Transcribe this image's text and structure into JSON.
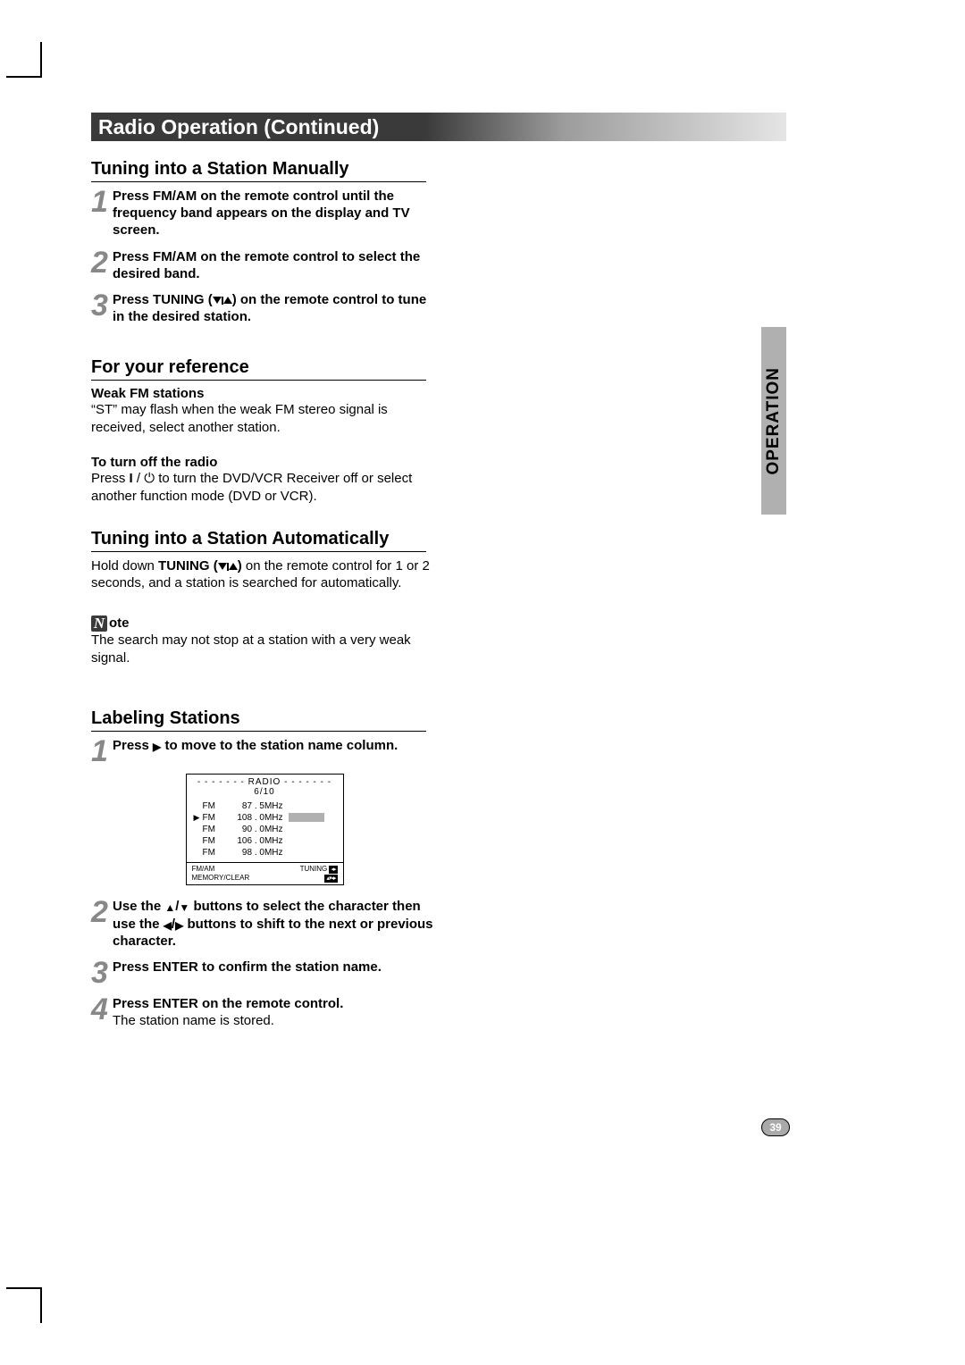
{
  "titleBar": "Radio Operation (Continued)",
  "sideTab": "OPERATION",
  "pageNumber": "39",
  "manual": {
    "heading": "Tuning into a Station Manually",
    "step1": "Press FM/AM on the remote control until the frequency band appears on the display and TV screen.",
    "step2": "Press FM/AM on the remote control to select the desired band.",
    "step3a": "Press TUNING (",
    "step3b": ") on the remote control to tune in the desired station."
  },
  "reference": {
    "heading": "For your reference",
    "weakHead": "Weak FM stations",
    "weakBody": "“ST” may flash when the weak FM stereo signal is received, select another station.",
    "offHead": "To turn off the radio",
    "offA": "Press ",
    "offB": " to turn the DVD/VCR Receiver off or select another function mode (DVD or VCR)."
  },
  "auto": {
    "heading": "Tuning into a Station Automatically",
    "bodyA": "Hold down ",
    "bodyBold": "TUNING (",
    "bodyBold2": ")",
    "bodyB": "  on the remote control for 1 or 2 seconds, and a station is searched for automatically.",
    "noteBody": "The search may not stop at a station with a very weak signal."
  },
  "label": {
    "heading": "Labeling Stations",
    "step1a": "Press ",
    "step1b": "  to move to the station name column.",
    "step2a": "Use the ",
    "step2b": " buttons to select the character then use the ",
    "step2c": " buttons to shift to the next or previous character.",
    "step3": "Press ENTER to confirm the station name.",
    "step4a": "Press ENTER on the remote control.",
    "step4b": "The station name is stored."
  },
  "radioPanel": {
    "header": "- - - - - - - RADIO - - - - - - - 6/10",
    "rows": [
      {
        "sel": "",
        "band": "FM",
        "freq": "87 . 5MHz",
        "active": false
      },
      {
        "sel": "▶",
        "band": "FM",
        "freq": "108 . 0MHz",
        "active": true
      },
      {
        "sel": "",
        "band": "FM",
        "freq": "90 . 0MHz",
        "active": false
      },
      {
        "sel": "",
        "band": "FM",
        "freq": "106 . 0MHz",
        "active": false
      },
      {
        "sel": "",
        "band": "FM",
        "freq": "98 . 0MHz",
        "active": false
      }
    ],
    "footerLeft1": "FM/AM",
    "footerLeft2": "MEMORY/CLEAR",
    "footerRight1": "TUNING",
    "footerRight2": ""
  }
}
